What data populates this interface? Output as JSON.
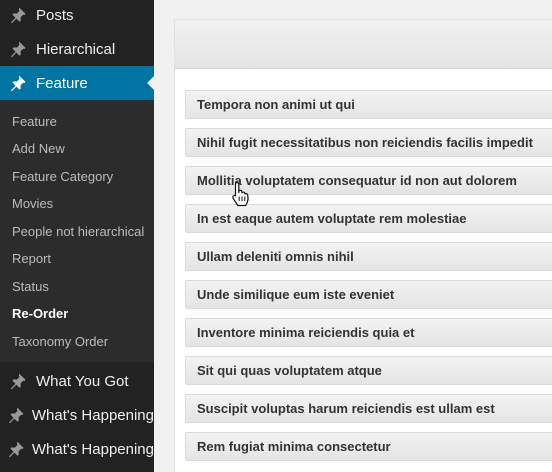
{
  "sidebar": {
    "top_items": [
      {
        "label": "Posts"
      },
      {
        "label": "Hierarchical"
      },
      {
        "label": "Feature"
      }
    ],
    "submenu": [
      {
        "label": "Feature"
      },
      {
        "label": "Add New"
      },
      {
        "label": "Feature Category"
      },
      {
        "label": "Movies"
      },
      {
        "label": "People not hierarchical"
      },
      {
        "label": "Report"
      },
      {
        "label": "Status"
      },
      {
        "label": "Re-Order"
      },
      {
        "label": "Taxonomy Order"
      }
    ],
    "bottom_items": [
      {
        "label": "What You Got"
      },
      {
        "label": "What's Happening"
      },
      {
        "label": "What's Happening"
      }
    ]
  },
  "reorder_list": [
    "Tempora non animi ut qui",
    "Nihil fugit necessitatibus non reiciendis facilis impedit",
    "Mollitia voluptatem consequatur id non aut dolorem",
    "In est eaque autem voluptate rem molestiae",
    "Ullam deleniti omnis nihil",
    "Unde similique eum iste eveniet",
    "Inventore minima reiciendis quia et",
    "Sit qui quas voluptatem atque",
    "Suscipit voluptas harum reiciendis est ullam est",
    "Rem fugiat minima consectetur"
  ],
  "icons": {
    "menu": "pushpin-icon",
    "cursor": "hand-pointer-icon"
  },
  "colors": {
    "sidebar_bg": "#222222",
    "submenu_bg": "#2c2c2c",
    "active_bg": "#0074a2",
    "content_bg": "#f1f1f1"
  }
}
